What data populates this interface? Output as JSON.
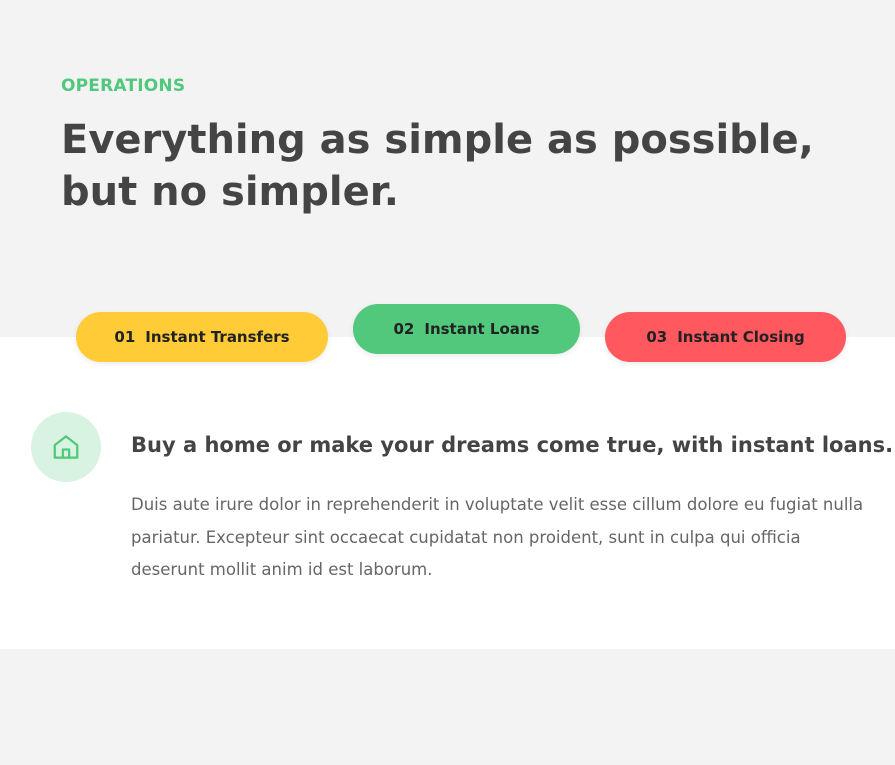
{
  "section": {
    "label": "OPERATIONS",
    "headline": "Everything as simple as possible, but no simpler."
  },
  "tabs": [
    {
      "number": "01",
      "label": "Instant Transfers",
      "color": "#ffcb37"
    },
    {
      "number": "02",
      "label": "Instant Loans",
      "color": "#51c87b"
    },
    {
      "number": "03",
      "label": "Instant Closing",
      "color": "#ff585f"
    }
  ],
  "content": {
    "icon": "home-icon",
    "heading": "Buy a home or make your dreams come true, with instant loans.",
    "body": "Duis aute irure dolor in reprehenderit in voluptate velit esse cillum dolore eu fugiat nulla pariatur. Excepteur sint occaecat cupidatat non proident, sunt in culpa qui officia deserunt mollit anim id est laborum."
  },
  "colors": {
    "accent_green": "#51c87b",
    "icon_bg": "#d9f3e2",
    "background": "#f3f3f3"
  }
}
